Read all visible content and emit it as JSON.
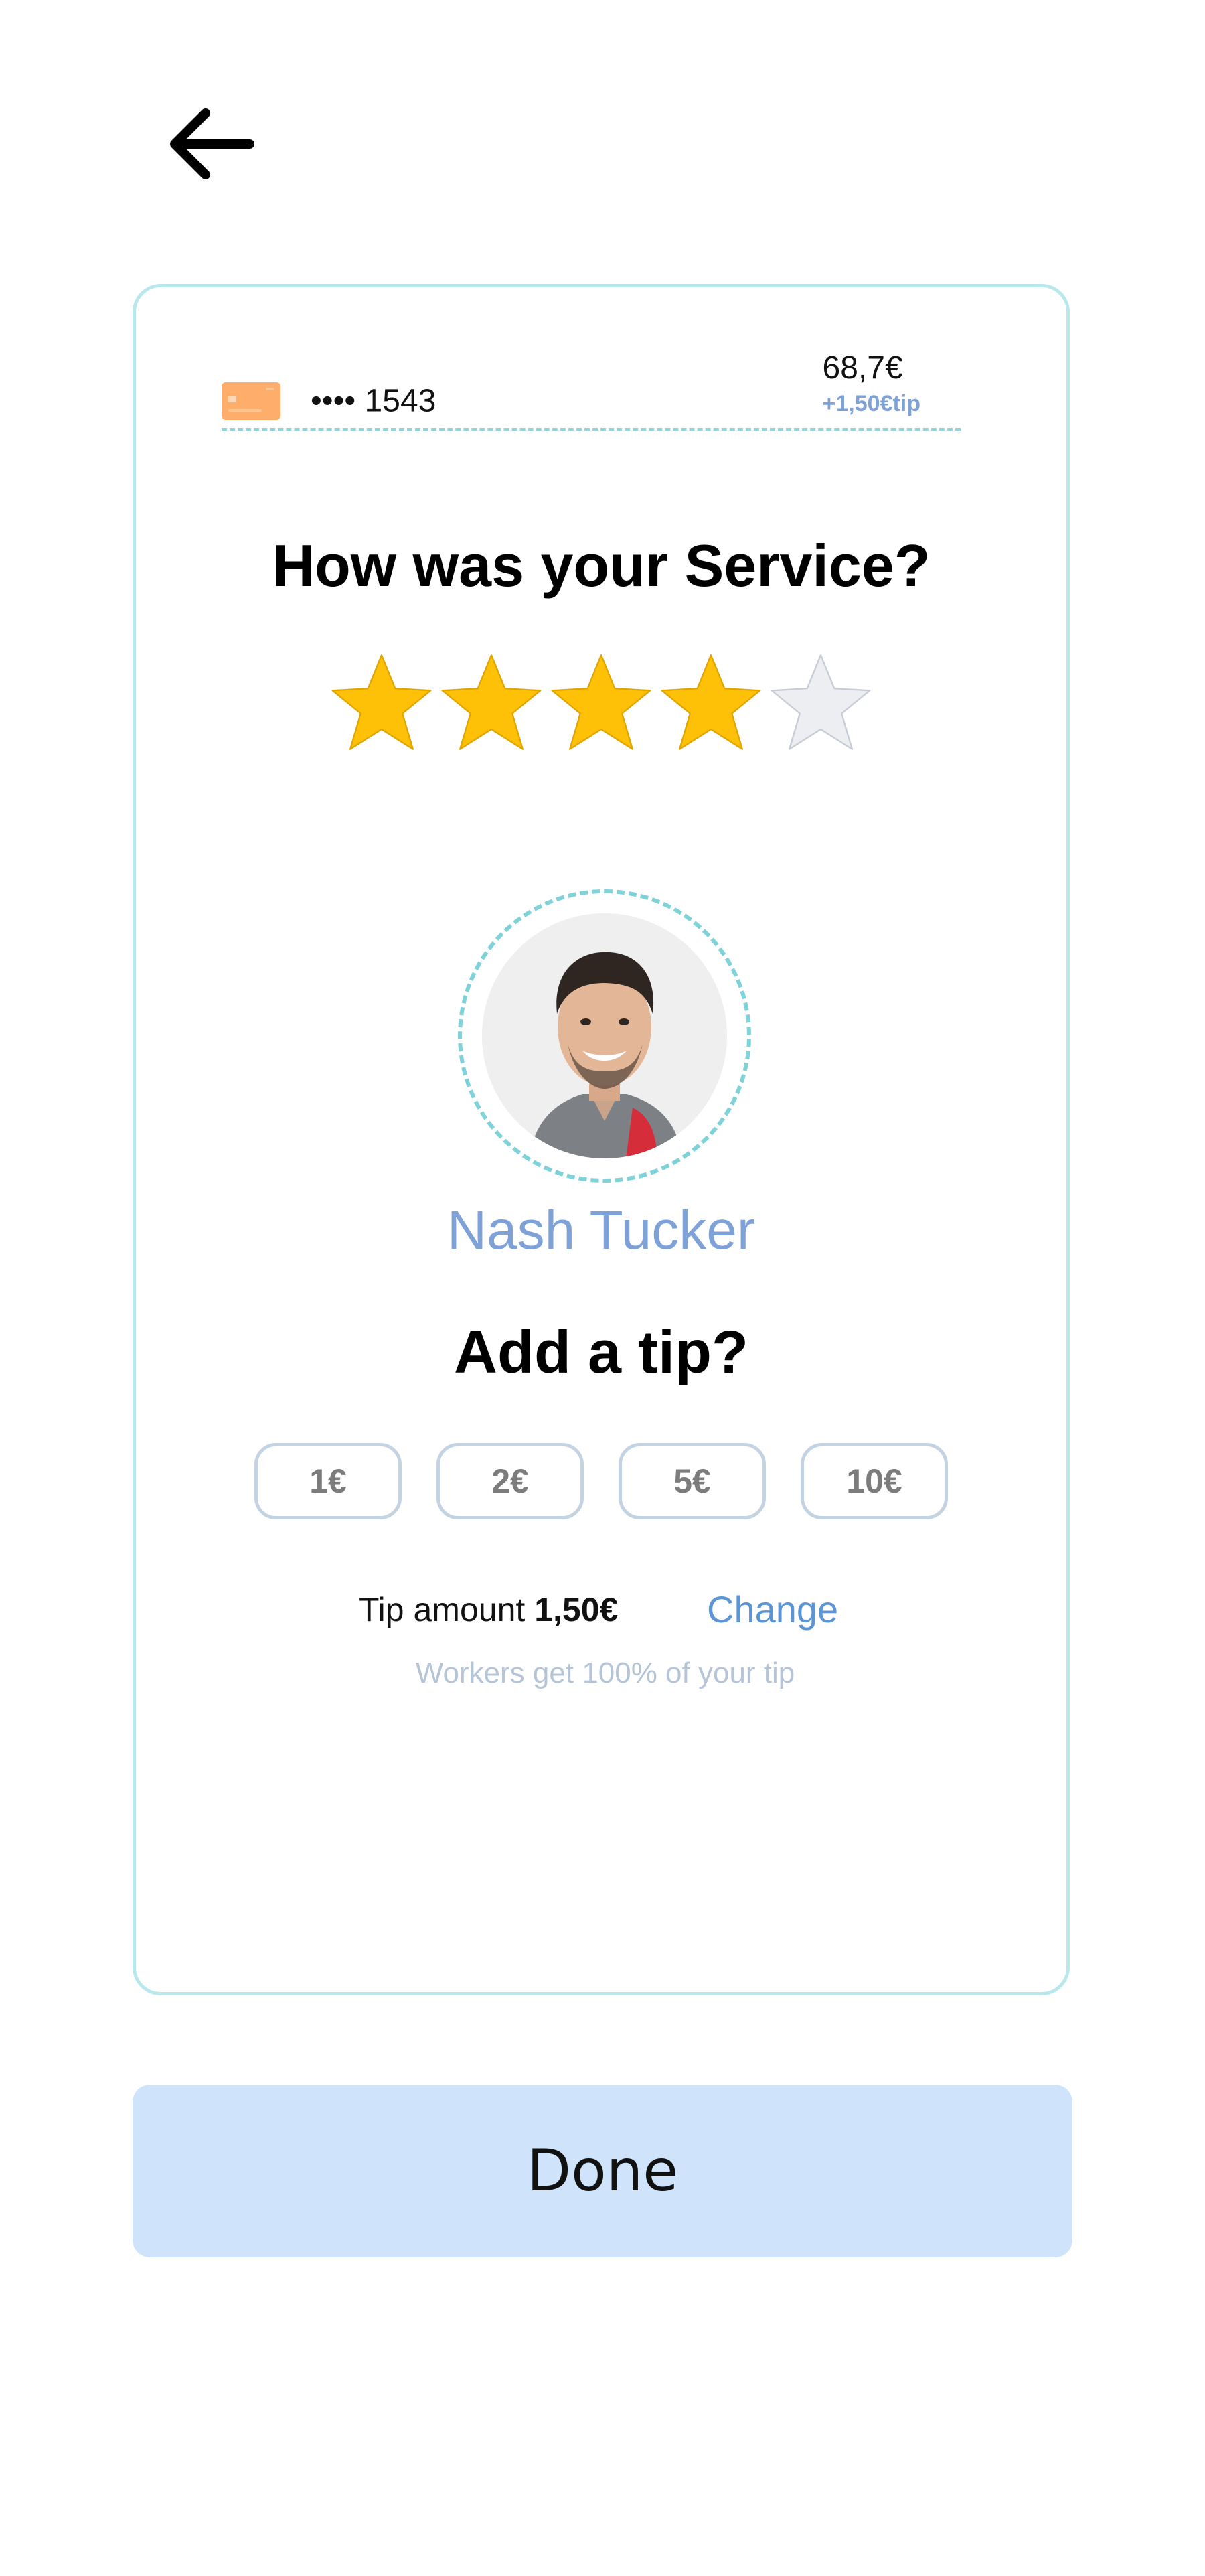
{
  "payment": {
    "card_masked": "•••• 1543",
    "card_icon": "credit-card-icon",
    "total": "68,7€",
    "tip_note": "+1,50€tip"
  },
  "rating": {
    "title": "How was your Service?",
    "value": 4,
    "max": 5
  },
  "worker": {
    "name": "Nash Tucker"
  },
  "tip": {
    "title": "Add a tip?",
    "options": [
      "1€",
      "2€",
      "5€",
      "10€"
    ],
    "amount_label": "Tip amount",
    "amount_value": "1,50€",
    "change_label": "Change",
    "note": "Workers get 100% of your tip"
  },
  "actions": {
    "done_label": "Done"
  },
  "colors": {
    "accent_teal": "#b8e8ec",
    "star_filled": "#ffc107",
    "star_empty": "#eceef1",
    "link_blue": "#5b95d6",
    "name_blue": "#7ea2d8",
    "done_bg": "#cfe3fb",
    "card_orange": "#ffad6b"
  }
}
